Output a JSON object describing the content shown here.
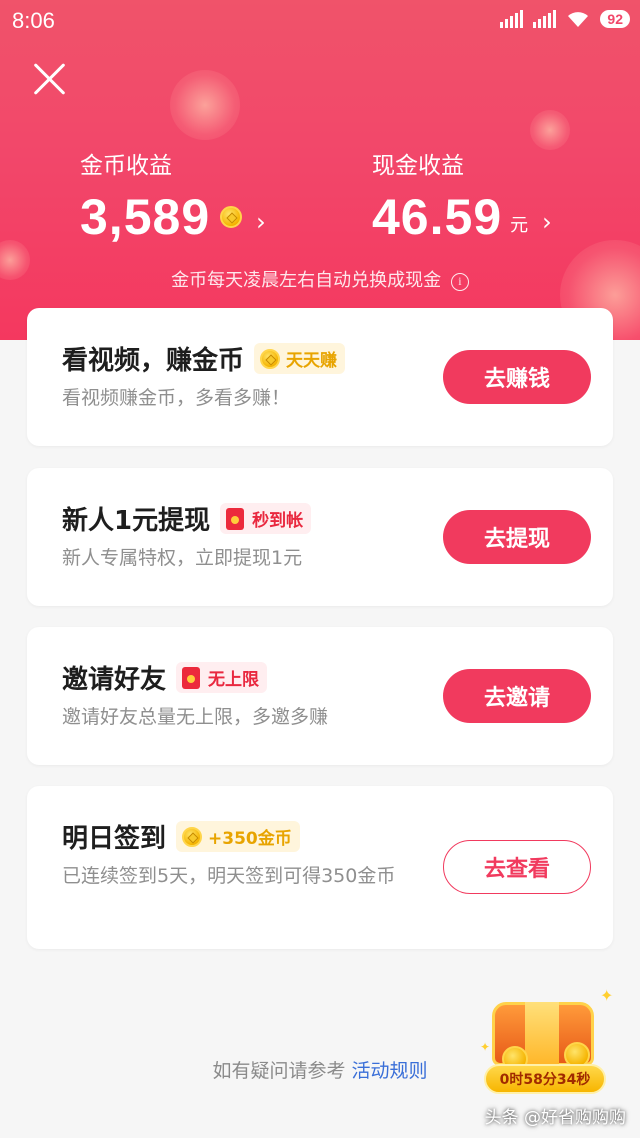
{
  "status_bar": {
    "time": "8:06",
    "battery": "92"
  },
  "stats": {
    "coins": {
      "label": "金币收益",
      "value": "3,589"
    },
    "cash": {
      "label": "现金收益",
      "value": "46.59",
      "unit": "元"
    },
    "chevron": "›",
    "note": "金币每天凌晨左右自动兑换成现金",
    "info": "i"
  },
  "cards": [
    {
      "title": "看视频，赚金币",
      "tag": "天天赚",
      "desc": "看视频赚金币，多看多赚！",
      "button": "去赚钱"
    },
    {
      "title": "新人1元提现",
      "tag": "秒到帐",
      "desc": "新人专属特权，立即提现1元",
      "button": "去提现"
    },
    {
      "title": "邀请好友",
      "tag": "无上限",
      "desc": "邀请好友总量无上限，多邀多赚",
      "button": "去邀请"
    },
    {
      "title": "明日签到",
      "tag": "+350金币",
      "desc": "已连续签到5天，明天签到可得350金币",
      "button": "去查看"
    }
  ],
  "footer": {
    "text": "如有疑问请参考",
    "link": "活动规则"
  },
  "treasure": {
    "countdown": "0时58分34秒"
  },
  "watermark": "头条 @好省购购购",
  "colors": {
    "accent": "#f13a5e",
    "header": "#f2476a",
    "gold_tag": "#e8a400",
    "link": "#3a6fd8"
  },
  "icons": [
    "close-icon",
    "coin-icon",
    "chevron-right-icon",
    "info-icon",
    "red-envelope-icon",
    "treasure-chest-icon"
  ]
}
